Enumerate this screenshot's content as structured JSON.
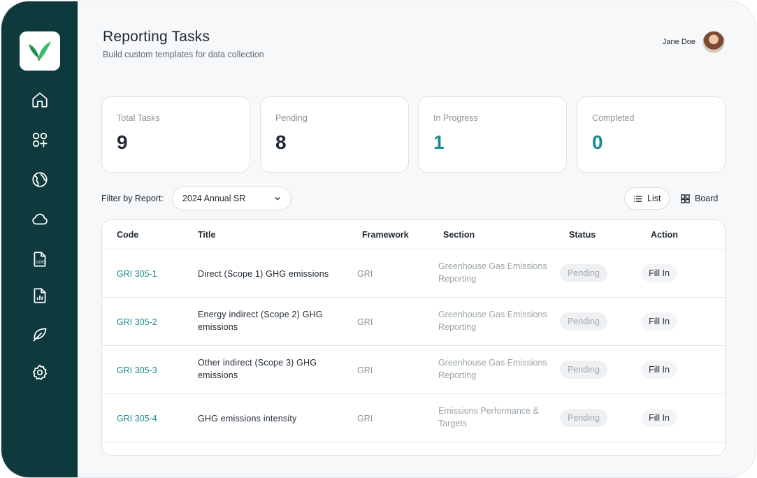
{
  "header": {
    "title": "Reporting Tasks",
    "subtitle": "Build custom templates for data collection",
    "user_name": "Jane Doe"
  },
  "sidebar": {
    "items": [
      {
        "icon": "home-icon"
      },
      {
        "icon": "apps-add-icon"
      },
      {
        "icon": "globe-icon"
      },
      {
        "icon": "cloud-icon"
      },
      {
        "icon": "log-file-icon",
        "label": "LOG"
      },
      {
        "icon": "report-file-icon"
      },
      {
        "icon": "leaf-icon"
      },
      {
        "icon": "settings-icon"
      }
    ]
  },
  "stats": [
    {
      "label": "Total Tasks",
      "value": "9"
    },
    {
      "label": "Pending",
      "value": "8"
    },
    {
      "label": "In Progress",
      "value": "1"
    },
    {
      "label": "Completed",
      "value": "0"
    }
  ],
  "filter": {
    "label": "Filter by Report:",
    "selected": "2024 Annual SR"
  },
  "views": {
    "list": "List",
    "board": "Board"
  },
  "table": {
    "headers": [
      "Code",
      "Title",
      "Framework",
      "Section",
      "Status",
      "Action"
    ],
    "rows": [
      {
        "code": "GRI 305-1",
        "title": "Direct (Scope 1) GHG emissions",
        "framework": "GRI",
        "section": "Greenhouse Gas Emissions Reporting",
        "status": "Pending",
        "action": "Fill In"
      },
      {
        "code": "GRI 305-2",
        "title": "Energy indirect (Scope 2) GHG emissions",
        "framework": "GRI",
        "section": "Greenhouse Gas Emissions Reporting",
        "status": "Pending",
        "action": "Fill In"
      },
      {
        "code": "GRI 305-3",
        "title": "Other indirect (Scope 3) GHG emissions",
        "framework": "GRI",
        "section": "Greenhouse Gas Emissions Reporting",
        "status": "Pending",
        "action": "Fill In"
      },
      {
        "code": "GRI 305-4",
        "title": "GHG emissions intensity",
        "framework": "GRI",
        "section": "Emissions Performance & Targets",
        "status": "Pending",
        "action": "Fill In"
      }
    ]
  },
  "colors": {
    "sidebar": "#0e3a3d",
    "accent": "#1a8b8f",
    "logo_green": "#3dbb6d"
  }
}
